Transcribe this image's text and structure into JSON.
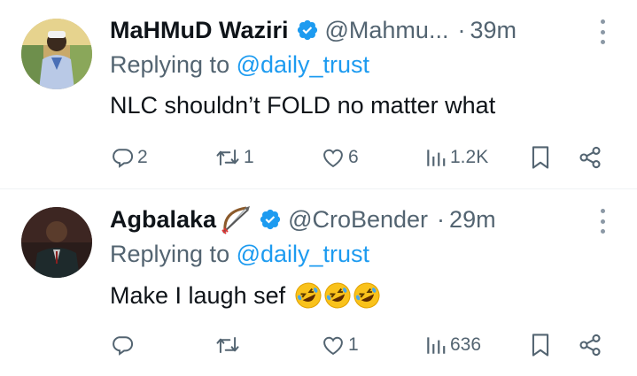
{
  "tweets": [
    {
      "name": "MaHMuD Waziri",
      "handle": "@Mahmu...",
      "dot": "·",
      "time": "39m",
      "replying_prefix": "Replying to ",
      "replying_to": "@daily_trust",
      "text": "NLC shouldn’t FOLD no matter what",
      "name_emoji": "",
      "actions": {
        "replies": "2",
        "reposts": "1",
        "likes": "6",
        "views": "1.2K"
      }
    },
    {
      "name": "Agbalaka",
      "name_emoji": "bow-and-arrow-icon",
      "handle": "@CroBender",
      "dot": "·",
      "time": "29m",
      "replying_prefix": "Replying to ",
      "replying_to": "@daily_trust",
      "text": "Make I laugh sef",
      "text_emojis": [
        "rolling-on-floor-laughing-icon",
        "rolling-on-floor-laughing-icon",
        "rolling-on-floor-laughing-icon"
      ],
      "actions": {
        "replies": "",
        "reposts": "",
        "likes": "1",
        "views": "636"
      }
    }
  ],
  "colors": {
    "accent": "#1d9bf0",
    "secondary_text": "#536471",
    "primary_text": "#0f1419"
  }
}
